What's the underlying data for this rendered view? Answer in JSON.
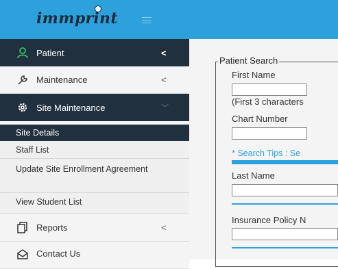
{
  "header": {
    "logo_text": "immprint",
    "accent_color": "#2da1dc"
  },
  "sidebar": {
    "items": [
      {
        "label": "Patient",
        "icon": "user-icon",
        "caret": "<"
      },
      {
        "label": "Maintenance",
        "icon": "wrench-icon",
        "caret": "<"
      },
      {
        "label": "Site Maintenance",
        "icon": "gear-icon",
        "caret": "﹀"
      },
      {
        "label": "Reports",
        "icon": "reports-icon",
        "caret": "<"
      },
      {
        "label": "Contact Us",
        "icon": "contact-icon"
      }
    ],
    "sub_items": [
      {
        "label": "Site Details"
      },
      {
        "label": "Staff List"
      },
      {
        "label": "Update Site Enrollment Agreement"
      },
      {
        "label": "View Student List"
      }
    ]
  },
  "patient_search": {
    "legend": "Patient Search",
    "first_name_label": "First Name",
    "first_name_hint": "(First 3 characters",
    "chart_number_label": "Chart Number",
    "search_tips": "* Search Tips : Se",
    "last_name_label": "Last Name",
    "insurance_label": "Insurance Policy N",
    "first_name_value": "",
    "chart_number_value": "",
    "last_name_value": "",
    "insurance_value": ""
  }
}
